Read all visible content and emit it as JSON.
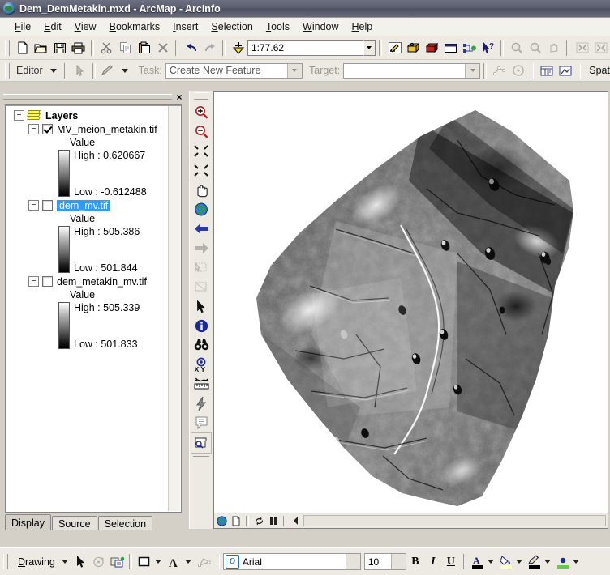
{
  "window": {
    "title": "Dem_DemMetakin.mxd - ArcMap - ArcInfo",
    "app_icon": "globe-icon"
  },
  "menubar": {
    "items": [
      {
        "label": "File",
        "accel": "F"
      },
      {
        "label": "Edit",
        "accel": "E"
      },
      {
        "label": "View",
        "accel": "V"
      },
      {
        "label": "Bookmarks",
        "accel": "B"
      },
      {
        "label": "Insert",
        "accel": "I"
      },
      {
        "label": "Selection",
        "accel": "S"
      },
      {
        "label": "Tools",
        "accel": "T"
      },
      {
        "label": "Window",
        "accel": "W"
      },
      {
        "label": "Help",
        "accel": "H"
      }
    ]
  },
  "standard_toolbar": {
    "buttons": [
      {
        "name": "new-document-icon"
      },
      {
        "name": "open-folder-icon"
      },
      {
        "name": "save-icon"
      },
      {
        "name": "print-icon"
      },
      {
        "name": "cut-scissors-icon"
      },
      {
        "name": "copy-icon"
      },
      {
        "name": "paste-icon"
      },
      {
        "name": "delete-x-icon"
      },
      {
        "name": "undo-icon"
      },
      {
        "name": "redo-icon"
      },
      {
        "name": "add-data-icon"
      }
    ],
    "scale": "1:77.62",
    "right_buttons": [
      {
        "name": "editor-toolbox-icon"
      },
      {
        "name": "arctoolbox-icon"
      },
      {
        "name": "model-builder-icon"
      },
      {
        "name": "command-window-icon"
      },
      {
        "name": "python-window-icon"
      },
      {
        "name": "whats-this-help-icon"
      },
      {
        "name": "zoom-in-disabled-icon"
      },
      {
        "name": "zoom-out-disabled-icon"
      },
      {
        "name": "pan-disabled-icon"
      },
      {
        "name": "full-extent-disabled-icon"
      },
      {
        "name": "fixed-zoom-disabled-icon"
      }
    ]
  },
  "editor_toolbar": {
    "editor_label": "Editor",
    "task_label": "Task:",
    "task_value": "Create New Feature",
    "target_label": "Target:",
    "target_value": "",
    "spatial_label": "Spat",
    "buttons": [
      {
        "name": "edit-arrow-icon"
      },
      {
        "name": "sketch-pencil-icon"
      },
      {
        "name": "sketch-tool-disabled-icon"
      },
      {
        "name": "rotate-disabled-icon"
      },
      {
        "name": "attributes-icon"
      },
      {
        "name": "sketch-properties-icon"
      }
    ]
  },
  "toc": {
    "close_button": "×",
    "root": {
      "label": "Layers",
      "icon": "layers-stack-icon",
      "expander": "−"
    },
    "layers": [
      {
        "name": "MV_meion_metakin.tif",
        "checked": true,
        "selected": false,
        "expander": "−",
        "value_label": "Value",
        "high": "High : 0.620667",
        "low": "Low : -0.612488"
      },
      {
        "name": "dem_mv.tif",
        "checked": false,
        "selected": true,
        "expander": "−",
        "value_label": "Value",
        "high": "High : 505.386",
        "low": "Low : 501.844"
      },
      {
        "name": "dem_metakin_mv.tif",
        "checked": false,
        "selected": false,
        "expander": "−",
        "value_label": "Value",
        "high": "High : 505.339",
        "low": "Low : 501.833"
      }
    ],
    "tabs": [
      {
        "label": "Display",
        "active": true
      },
      {
        "label": "Source",
        "active": false
      },
      {
        "label": "Selection",
        "active": false
      }
    ]
  },
  "tool_palette": {
    "tools": [
      {
        "name": "zoom-in-icon"
      },
      {
        "name": "zoom-out-icon"
      },
      {
        "name": "fixed-zoom-in-icon"
      },
      {
        "name": "fixed-zoom-out-icon"
      },
      {
        "name": "pan-hand-icon"
      },
      {
        "name": "full-extent-globe-icon"
      },
      {
        "name": "go-back-extent-icon"
      },
      {
        "name": "go-forward-extent-icon"
      },
      {
        "name": "select-features-disabled-icon"
      },
      {
        "name": "clear-selection-disabled-icon"
      },
      {
        "name": "select-elements-arrow-icon"
      },
      {
        "name": "identify-info-icon"
      },
      {
        "name": "find-binoculars-icon"
      },
      {
        "name": "go-to-xy-icon"
      },
      {
        "name": "measure-ruler-icon"
      },
      {
        "name": "hyperlink-lightning-icon"
      },
      {
        "name": "html-popup-icon"
      },
      {
        "name": "time-slider-icon"
      }
    ]
  },
  "map": {
    "status_buttons": [
      {
        "name": "map-globe-icon"
      },
      {
        "name": "map-page-icon"
      },
      {
        "name": "refresh-icon"
      },
      {
        "name": "pause-drawing-icon"
      },
      {
        "name": "scroll-left-icon"
      }
    ],
    "raster_description": "grayscale hillshade DEM of rotated rectangular survey block"
  },
  "drawing_toolbar": {
    "drawing_label": "Drawing",
    "font_name": "Arial",
    "font_size": "10",
    "bold": "B",
    "italic": "I",
    "underline": "U",
    "buttons": [
      {
        "name": "select-elements-arrow-icon"
      },
      {
        "name": "rotate-element-disabled-icon"
      },
      {
        "name": "convert-graphics-icon"
      },
      {
        "name": "new-rectangle-icon"
      },
      {
        "name": "new-text-icon"
      },
      {
        "name": "nudge-disabled-icon"
      }
    ],
    "color_buttons": [
      {
        "name": "font-color-icon",
        "swatch": "#000000"
      },
      {
        "name": "fill-color-icon",
        "swatch": "#ffffcc"
      },
      {
        "name": "line-color-icon",
        "swatch": "#000000"
      },
      {
        "name": "marker-color-icon",
        "swatch": "#66cc44"
      }
    ]
  },
  "colors": {
    "titlebar": "#5b5e6e",
    "chrome": "#d4d0c8",
    "toolbar": "#eceae3",
    "selection_blue": "#3399ff",
    "accent_yellow": "#ffff33"
  }
}
